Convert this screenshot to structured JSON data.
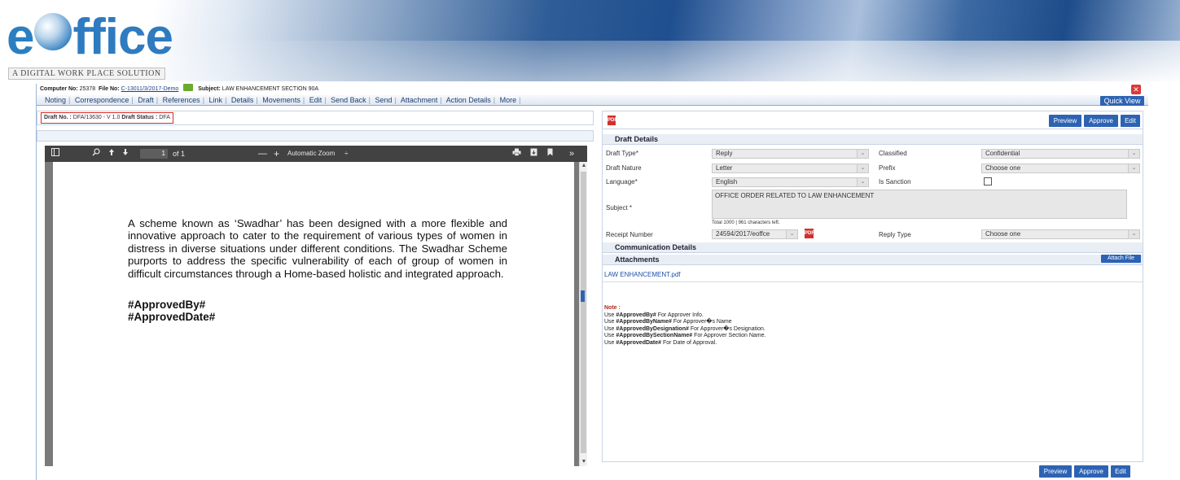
{
  "brand": {
    "logo_e": "e",
    "logo_rest": "ffice",
    "tagline": "A DIGITAL WORK PLACE SOLUTION"
  },
  "infobar": {
    "computer_label": "Computer No:",
    "computer_no": "25378",
    "file_label": "File No:",
    "file_no": "C-13011/3/2017-Demo",
    "subject_label": "Subject:",
    "subject": "LAW ENHANCEMENT SECTION 90A",
    "close": "✕"
  },
  "menu": {
    "items": [
      "Noting",
      "Correspondence",
      "Draft",
      "References",
      "Link",
      "Details",
      "Movements",
      "Edit",
      "Send Back",
      "Send",
      "Attachment",
      "Action Details",
      "More"
    ],
    "quick_view": "Quick View"
  },
  "draft": {
    "no_label": "Draft No. :",
    "no": "DFA/13630 - V 1.0",
    "status_label": "Draft Status :",
    "status": "DFA"
  },
  "pdf_toolbar": {
    "page_current": "1",
    "page_total": "of 1",
    "zoom": "Automatic Zoom",
    "zoom_caret": "÷",
    "minus": "—",
    "plus": "+",
    "more": "»"
  },
  "document": {
    "body": "A scheme known as ‘Swadhar’ has been designed with a more flexible and innovative approach to cater to the requirement of various types of women in distress in diverse situations under different conditions. The Swadhar Scheme purports to address the specific vulnerability of each of group of women in difficult circumstances through a Home-based holistic and integrated approach.",
    "tag1": "#ApprovedBy#",
    "tag2": "#ApprovedDate#"
  },
  "actions": {
    "preview": "Preview",
    "approve": "Approve",
    "edit": "Edit"
  },
  "draft_details": {
    "section": "Draft Details",
    "draft_type_label": "Draft Type*",
    "draft_type": "Reply",
    "classified_label": "Classified",
    "classified": "Confidential",
    "draft_nature_label": "Draft Nature",
    "draft_nature": "Letter",
    "prefix_label": "Prefix",
    "prefix": "Choose one",
    "language_label": "Language*",
    "language": "English",
    "is_sanction_label": "Is Sanction",
    "subject_label": "Subject *",
    "subject": "OFFICE ORDER RELATED TO LAW ENHANCEMENT",
    "counter": "Total 1000 |  961   characters left.",
    "receipt_label": "Receipt Number",
    "receipt": "24594/2017/eoffce",
    "reply_type_label": "Reply Type",
    "reply_type": "Choose one"
  },
  "communication": {
    "section": "Communication Details"
  },
  "attachments": {
    "section": "Attachments",
    "attach_button": "Attach File",
    "file": "LAW ENHANCEMENT.pdf"
  },
  "note": {
    "label": "Note :",
    "lines": [
      {
        "pre": "Use ",
        "tag": "#ApprovedBy#",
        "post": " For Approver Info."
      },
      {
        "pre": "Use ",
        "tag": "#ApprovedByName#",
        "post": " For Approver�s Name"
      },
      {
        "pre": "Use ",
        "tag": "#ApprovedByDesignation#",
        "post": " For Approver�s Designation."
      },
      {
        "pre": "Use ",
        "tag": "#ApprovedBySectionName#",
        "post": " For Approver Section Name."
      },
      {
        "pre": "Use ",
        "tag": "#ApprovedDate#",
        "post": " For Date of Approval."
      }
    ]
  },
  "colors": {
    "accent": "#2d63b3",
    "brand_blue": "#2b7fc1",
    "alert_red": "#d92c2c"
  },
  "icons": [
    "sidebar-toggle-icon",
    "search-icon",
    "arrow-up-icon",
    "arrow-down-icon",
    "print-icon",
    "download-icon",
    "bookmark-icon",
    "pdf-icon",
    "close-icon",
    "note-icon"
  ]
}
